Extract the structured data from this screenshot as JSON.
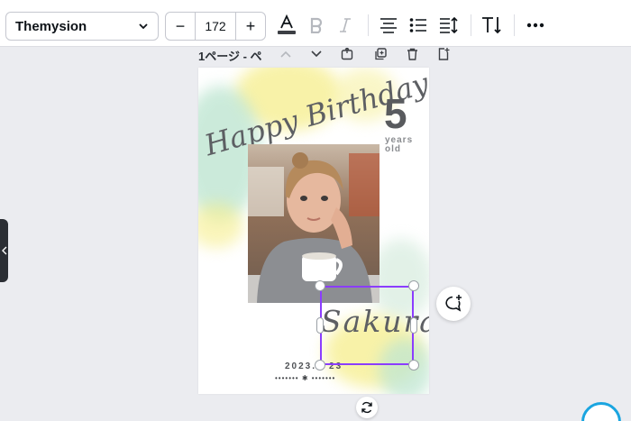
{
  "toolbar": {
    "font_name": "Themysion",
    "font_size": "172",
    "minus": "−",
    "plus": "+",
    "text_color": "#3c3f44"
  },
  "page_header": {
    "title": "1ページ - ペ"
  },
  "design": {
    "title_line": "Happy Birthday",
    "age_number": "5",
    "age_caption_1": "years",
    "age_caption_2": "old",
    "name": "Sakura",
    "date": "2023.",
    "date_suffix": "23",
    "dots": "••••••• ✱ •••••••"
  },
  "colors": {
    "accent": "#8b3dff",
    "watercolor_yellow": "#f7ef8a",
    "watercolor_mint": "#bfe6d2"
  }
}
